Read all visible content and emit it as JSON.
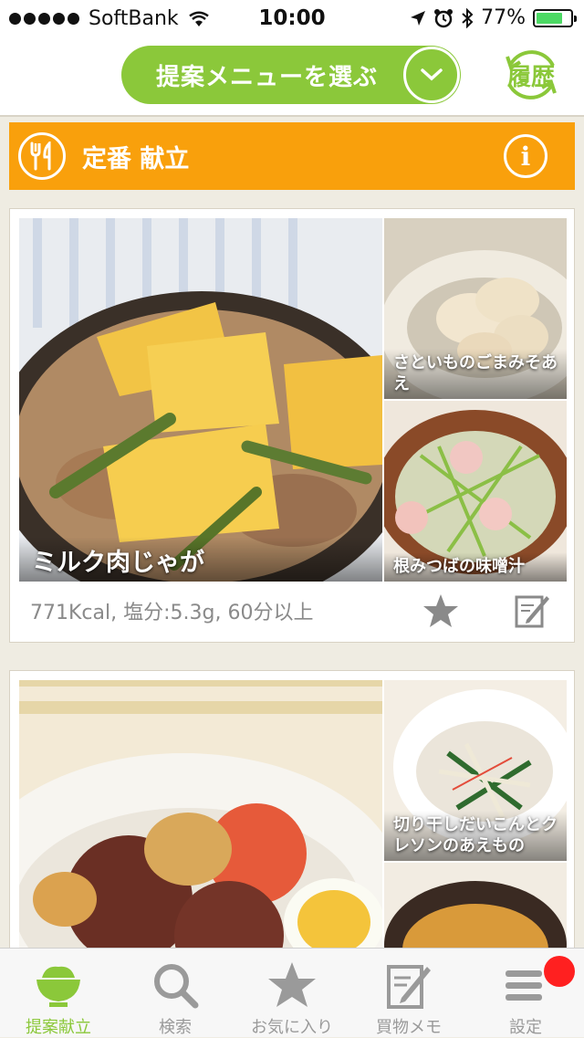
{
  "status_bar": {
    "carrier": "SoftBank",
    "time": "10:00",
    "battery_percent": "77%",
    "battery_level": 0.77
  },
  "nav": {
    "menu_button_label": "提案メニューを選ぶ",
    "history_label": "履歴"
  },
  "section": {
    "title": "定番 献立"
  },
  "cards": [
    {
      "main_dish": "ミルク肉じゃが",
      "side1": "さといものごまみそあえ",
      "side2": "根みつばの味噌汁",
      "info": "771Kcal, 塩分:5.3g, 60分以上"
    },
    {
      "side1": "切り干しだいこんとクレソンのあえもの"
    }
  ],
  "tabs": [
    {
      "label": "提案献立",
      "icon": "rice-bowl-icon",
      "active": true
    },
    {
      "label": "検索",
      "icon": "search-icon"
    },
    {
      "label": "お気に入り",
      "icon": "star-icon"
    },
    {
      "label": "買物メモ",
      "icon": "memo-icon"
    },
    {
      "label": "設定",
      "icon": "menu-icon",
      "badge": true
    }
  ],
  "colors": {
    "accent_green": "#8bc83a",
    "section_orange": "#f9a00c",
    "background": "#efece2",
    "badge_red": "#ff2020"
  }
}
